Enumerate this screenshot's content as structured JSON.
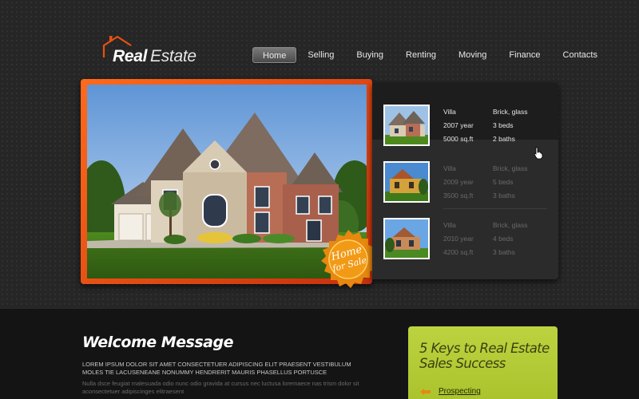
{
  "brand": {
    "word1": "Real",
    "word2": "Estate"
  },
  "nav": {
    "items": [
      {
        "label": "Home",
        "active": true
      },
      {
        "label": "Selling"
      },
      {
        "label": "Buying"
      },
      {
        "label": "Renting"
      },
      {
        "label": "Moving"
      },
      {
        "label": "Finance"
      },
      {
        "label": "Contacts"
      }
    ]
  },
  "hero": {
    "seal_line1": "Home",
    "seal_line2": "for Sale"
  },
  "listings": [
    {
      "type": "Villa",
      "year": "2007 year",
      "area": "5000 sq.ft",
      "material": "Brick, glass",
      "beds": "3 beds",
      "baths": "2 baths"
    },
    {
      "type": "Villa",
      "year": "2009 year",
      "area": "3500 sq.ft",
      "material": "Brick, glass",
      "beds": "5 beds",
      "baths": "3 baths"
    },
    {
      "type": "Villa",
      "year": "2010 year",
      "area": "4200 sq.ft",
      "material": "Brick, glass",
      "beds": "4 beds",
      "baths": "3 baths"
    }
  ],
  "welcome": {
    "title": "Welcome Message",
    "upper": "LOREM IPSUM DOLOR SIT AMET CONSECTETUER ADIPISCING ELIT PRAESENT VESTIBULUM MOLES TIE LACUSENEANE NONUMMY HENDRERIT MAURIS PHASELLUS PORTUSCE",
    "body": "Nulla dsce feugiat malesuada odio nunc odio gravida at cursus nec luctusa loremaece nas trism dolor sit aconsectetuer adipiscinges elitraesent"
  },
  "promo": {
    "title": "5 Keys to Real Estate Sales Success",
    "link": "Prospecting"
  },
  "colors": {
    "accent_orange": "#e8520f",
    "promo_green": "#b5cc36"
  }
}
